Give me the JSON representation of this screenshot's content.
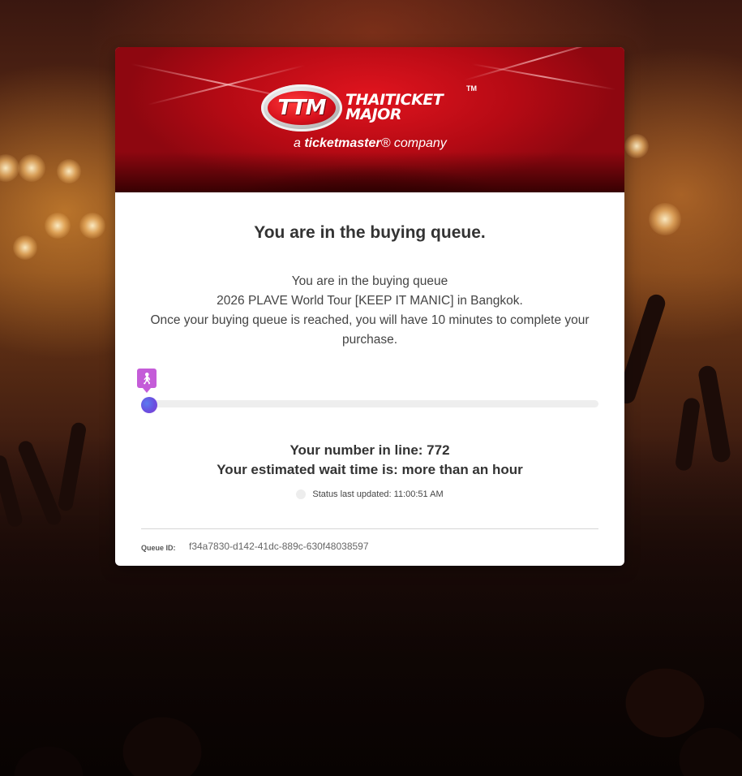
{
  "brand": {
    "logo_mark": "TTM",
    "name": "THAITICKET\nMAJOR",
    "trademark": "TM",
    "tagline_prefix": "a ",
    "tagline_brand": "ticketmaster",
    "tagline_suffix": "® company"
  },
  "queue": {
    "title": "You are in the buying queue.",
    "message_line1": "You are in the buying queue",
    "message_line2": "2026 PLAVE World Tour [KEEP IT MANIC] in Bangkok.",
    "message_line3": "Once your buying queue is reached, you will have 10 minutes to complete your purchase.",
    "progress_fraction": 0.0,
    "number_in_line": "Your number in line: 772",
    "estimated_wait": "Your estimated wait time is: more than an hour",
    "status_updated": "Status last updated: 11:00:51 AM",
    "queue_id_label": "Queue ID:",
    "queue_id_value": "f34a7830-d142-41dc-889c-630f48038597"
  },
  "icons": {
    "walker": "walking-person-icon",
    "status": "status-dot-icon"
  },
  "colors": {
    "banner_red": "#c80c16",
    "marker_purple": "#c45cd8",
    "knob_blue": "#5b7cf0"
  }
}
